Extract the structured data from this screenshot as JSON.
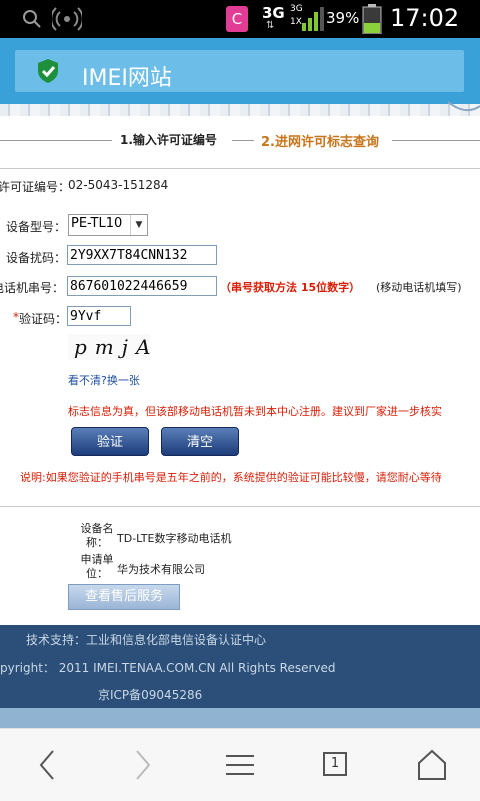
{
  "status_bar": {
    "app_badge": "C",
    "net_top": "3G",
    "net_small_top": "3G",
    "net_small_bottom": "1X",
    "battery_percent": "39%",
    "time": "17:02",
    "icons": [
      "search-icon",
      "wifi-icon",
      "app-notification-icon",
      "signal-icon",
      "battery-icon"
    ]
  },
  "title_bar": {
    "title": "IMEI网站",
    "icon": "shield-check-icon",
    "accent": "#3aa0d8"
  },
  "steps": {
    "step1": "1.输入许可证编号",
    "step2": "2.进网许可标志查询"
  },
  "license": {
    "label": "许可证编号：",
    "value": "02-5043-151284"
  },
  "form": {
    "model_label": "设备型号：",
    "model_value": "PE-TL10",
    "scramble_label": "设备扰码：",
    "scramble_value": "2Y9XX7T84CNN132",
    "serial_label": "电话机串号：",
    "serial_value": "867601022446659",
    "serial_hint_red": "（串号获取方法 15位数字）",
    "serial_hint_black": "(移动电话机填写)",
    "captcha_star": "*",
    "captcha_label": "验证码：",
    "captcha_value": "9Yvf",
    "captcha_image_text": "pmjA",
    "refresh_link": "看不清?换一张",
    "result_message": "标志信息为真，但该部移动电话机暂未到本中心注册。建议到厂家进一步核实",
    "verify_button": "验证",
    "clear_button": "清空",
    "note": "说明:如果您验证的手机串号是五年之前的，系统提供的验证可能比较慢，请您耐心等待"
  },
  "result": {
    "device_name_label": "设备名称：",
    "device_name_value": "TD-LTE数字移动电话机",
    "applicant_label": "申请单位：",
    "applicant_value": "华为技术有限公司",
    "after_sale_button": "查看售后服务"
  },
  "footer": {
    "support": "技术支持：工业和信息化部电信设备认证中心",
    "copyright": "pyright： 2011 IMEI.TENAA.COM.CN All Rights Reserved",
    "icp": "京ICP备09045286"
  },
  "browser_nav": {
    "icons": [
      "back-icon",
      "forward-icon",
      "menu-icon",
      "tabs-icon",
      "home-icon"
    ],
    "tab_count": "1"
  }
}
